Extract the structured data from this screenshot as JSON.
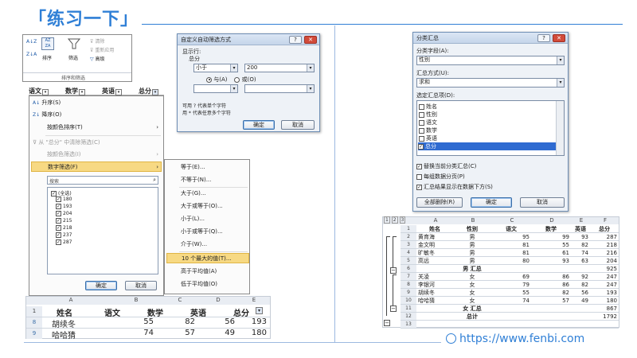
{
  "title": "「练习一下」",
  "watermark": "https://www.fenbi.com",
  "ribbon": {
    "sort_asc": "A↓Z",
    "sort_desc": "Z↓A",
    "sort_label": "排序",
    "filter_label": "筛选",
    "clear": "清除",
    "reapply": "重新应用",
    "advanced": "高级",
    "group": "排序和筛选"
  },
  "filter_header": [
    "语文",
    "数学",
    "英语",
    "总分"
  ],
  "dropdown": {
    "items": [
      "升序(S)",
      "降序(O)",
      "按颜色排序(T)",
      "从 \"总分\" 中清除筛选(C)",
      "按颜色筛选(I)",
      "数字筛选(F)"
    ],
    "search": "搜索",
    "checks": [
      "(全选)",
      "180",
      "193",
      "204",
      "215",
      "218",
      "237",
      "287"
    ],
    "ok": "确定",
    "cancel": "取消"
  },
  "submenu": [
    "等于(E)...",
    "不等于(N)...",
    "大于(G)...",
    "大于或等于(O)...",
    "小于(L)...",
    "小于或等于(Q)...",
    "介于(W)...",
    "10 个最大的值(T)...",
    "高于平均值(A)",
    "低于平均值(O)"
  ],
  "custom_filter": {
    "title": "自定义自动筛选方式",
    "show_rows": "显示行:",
    "field": "总分",
    "op1": "小于",
    "val1": "200",
    "and": "与(A)",
    "or": "或(O)",
    "hint1": "可用 ? 代表单个字符",
    "hint2": "用 * 代表任意多个字符",
    "ok": "确定",
    "cancel": "取消"
  },
  "left_sheet": {
    "cols": [
      "A",
      "B",
      "C",
      "D",
      "E"
    ],
    "rows": [
      {
        "num": "1",
        "cells": [
          "姓名",
          "语文",
          "数学",
          "英语",
          "总分"
        ]
      },
      {
        "num": "8",
        "cells": [
          "胡续冬",
          "55",
          "82",
          "56",
          "193"
        ]
      },
      {
        "num": "9",
        "cells": [
          "哈哈猜",
          "74",
          "57",
          "49",
          "180"
        ]
      }
    ]
  },
  "subtotal": {
    "title": "分类汇总",
    "field_label": "分类字段(A):",
    "field_value": "性别",
    "func_label": "汇总方式(U):",
    "func_value": "求和",
    "items_label": "选定汇总项(D):",
    "items": [
      "姓名",
      "性别",
      "语文",
      "数学",
      "英语",
      "总分"
    ],
    "opt1": "替换当前分类汇总(C)",
    "opt2": "每组数据分页(P)",
    "opt3": "汇总结果显示在数据下方(S)",
    "remove_all": "全部删除(R)",
    "ok": "确定",
    "cancel": "取消"
  },
  "right_sheet": {
    "levels": [
      "1",
      "2",
      "3"
    ],
    "cols": [
      "A",
      "B",
      "C",
      "D",
      "E",
      "F"
    ],
    "rows": [
      {
        "num": "1",
        "cells": [
          "姓名",
          "性别",
          "语文",
          "数学",
          "英语",
          "总分"
        ]
      },
      {
        "num": "2",
        "cells": [
          "黄育海",
          "男",
          "95",
          "99",
          "93",
          "287"
        ]
      },
      {
        "num": "3",
        "cells": [
          "金文明",
          "男",
          "81",
          "55",
          "82",
          "218"
        ]
      },
      {
        "num": "4",
        "cells": [
          "旷敏冬",
          "男",
          "81",
          "61",
          "74",
          "216"
        ]
      },
      {
        "num": "5",
        "cells": [
          "高远",
          "男",
          "80",
          "93",
          "63",
          "204"
        ]
      },
      {
        "num": "6",
        "cells": [
          "",
          "男 汇总",
          "",
          "",
          "",
          "925"
        ]
      },
      {
        "num": "7",
        "cells": [
          "关凌",
          "女",
          "69",
          "86",
          "92",
          "247"
        ]
      },
      {
        "num": "8",
        "cells": [
          "李银河",
          "女",
          "79",
          "86",
          "82",
          "247"
        ]
      },
      {
        "num": "9",
        "cells": [
          "胡续冬",
          "女",
          "55",
          "82",
          "56",
          "193"
        ]
      },
      {
        "num": "10",
        "cells": [
          "哈哈猜",
          "女",
          "74",
          "57",
          "49",
          "180"
        ]
      },
      {
        "num": "11",
        "cells": [
          "",
          "女 汇总",
          "",
          "",
          "",
          "867"
        ]
      },
      {
        "num": "12",
        "cells": [
          "",
          "总计",
          "",
          "",
          "",
          "1792"
        ]
      },
      {
        "num": "13",
        "cells": [
          "",
          "",
          "",
          "",
          "",
          ""
        ]
      }
    ]
  }
}
